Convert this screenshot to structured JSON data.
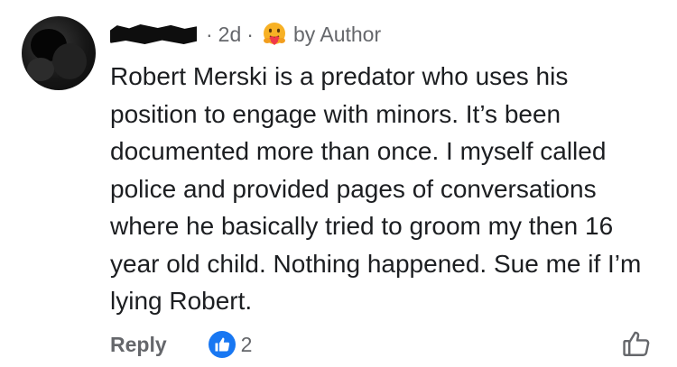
{
  "comment": {
    "time": "2d",
    "separator": "·",
    "author_badge": "by Author",
    "badge_icon": "care-reaction-icon",
    "text": "Robert Merski is a predator who uses his position to engage with minors. It’s been documented more than once. I myself called police and provided pages of conversations where he basically tried to groom my then 16 year old child. Nothing happened. Sue me if I’m lying Robert."
  },
  "actions": {
    "reply_label": "Reply",
    "reaction_count": "2",
    "reaction_icon": "like-icon",
    "like_button_icon": "thumbs-up-outline-icon"
  },
  "colors": {
    "meta_text": "#65676b",
    "body_text": "#1c1e21",
    "like_blue": "#1877f2"
  }
}
